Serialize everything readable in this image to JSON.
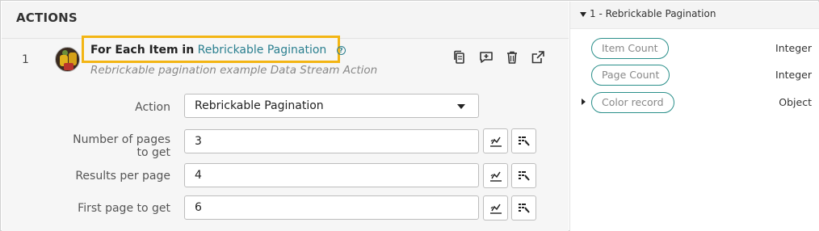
{
  "panel": {
    "title": "ACTIONS"
  },
  "step": {
    "number": "1",
    "title_prefix": "For Each Item in",
    "title_link": "Rebrickable Pagination",
    "help_icon": "?",
    "subtitle": "Rebrickable pagination example Data Stream Action"
  },
  "toolbar": {
    "icons": [
      "copy-icon",
      "comment-add-icon",
      "trash-icon",
      "open-external-icon"
    ]
  },
  "fields": {
    "action": {
      "label": "Action",
      "value": "Rebrickable Pagination"
    },
    "pages": {
      "label": "Number of pages to get",
      "value": "3"
    },
    "results": {
      "label": "Results per page",
      "value": "4"
    },
    "first_page": {
      "label": "First page to get",
      "value": "6"
    }
  },
  "data_panel": {
    "title": "1 - Rebrickable Pagination",
    "items": [
      {
        "label": "Item Count",
        "type": "Integer"
      },
      {
        "label": "Page Count",
        "type": "Integer"
      },
      {
        "label": "Color record",
        "type": "Object"
      }
    ]
  },
  "colors": {
    "accent": "#2a7f8f",
    "highlight": "#f3b514",
    "pill_border": "#2a8f8a"
  }
}
